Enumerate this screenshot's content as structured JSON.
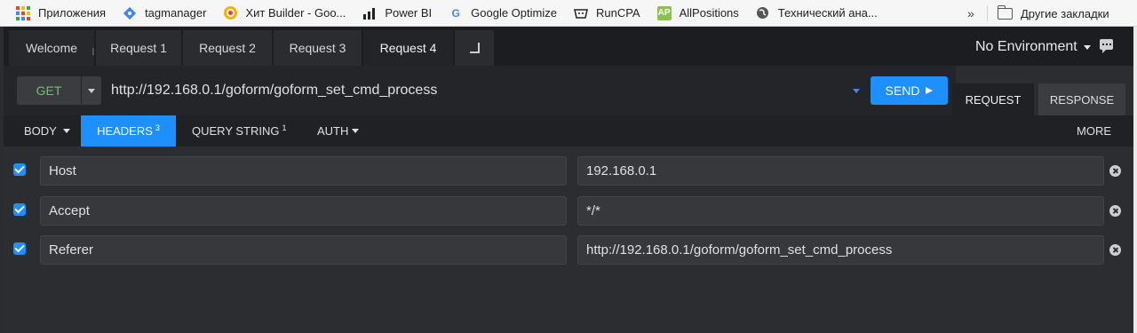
{
  "bookmarks": {
    "items": [
      {
        "label": "Приложения",
        "icon": "apps-grid-icon"
      },
      {
        "label": "tagmanager",
        "icon": "tagmanager-icon"
      },
      {
        "label": "Хит Builder - Goo...",
        "icon": "google-drive-icon"
      },
      {
        "label": "Power BI",
        "icon": "bar-chart-icon"
      },
      {
        "label": "Google Optimize",
        "icon": "google-g-icon"
      },
      {
        "label": "RunCPA",
        "icon": "runcpa-icon"
      },
      {
        "label": "AllPositions",
        "icon": "allpositions-icon"
      },
      {
        "label": "Технический ана...",
        "icon": "globe-icon"
      }
    ],
    "overflow": "»",
    "other": "Другие закладки"
  },
  "tabs": {
    "welcome": "Welcome",
    "items": [
      "Request 1",
      "Request 2",
      "Request 3",
      "Request 4"
    ],
    "active": "Request 4",
    "new_tab_icon": "new-tab-icon"
  },
  "environment": {
    "label": "No Environment"
  },
  "request": {
    "method": "GET",
    "url": "http://192.168.0.1/goform/goform_set_cmd_process",
    "send_label": "SEND"
  },
  "panel_tabs": {
    "request": "REQUEST",
    "response": "RESPONSE"
  },
  "subtabs": {
    "body": "BODY",
    "headers": "HEADERS",
    "headers_count": "3",
    "query_string": "QUERY STRING",
    "query_count": "1",
    "auth": "AUTH",
    "more": "MORE"
  },
  "headers": [
    {
      "key": "Host",
      "value": "192.168.0.1",
      "enabled": true
    },
    {
      "key": "Accept",
      "value": "*/*",
      "enabled": true
    },
    {
      "key": "Referer",
      "value": "http://192.168.0.1/goform/goform_set_cmd_process",
      "enabled": true
    }
  ],
  "colors": {
    "accent": "#1e8fff",
    "method_get": "#6cc56c",
    "background": "#2b2d31"
  }
}
